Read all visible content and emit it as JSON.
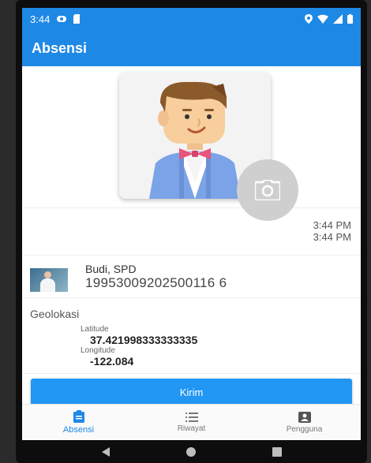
{
  "status_bar": {
    "time": "3:44"
  },
  "app_bar": {
    "title": "Absensi"
  },
  "time_info": {
    "line1": "3:44 PM",
    "line2": "3:44 PM"
  },
  "user": {
    "name": "Budi, SPD",
    "nip": "19953009202500116 6"
  },
  "geo": {
    "title": "Geolokasi",
    "latitude_label": "Latitude",
    "latitude_value": "37.421998333333335",
    "longitude_label": "Longitude",
    "longitude_value": "-122.084"
  },
  "submit": {
    "label": "Kirim"
  },
  "bottom_nav": {
    "items": [
      {
        "label": "Absensi",
        "icon": "clipboard-icon"
      },
      {
        "label": "Riwayat",
        "icon": "list-icon"
      },
      {
        "label": "Pengguna",
        "icon": "person-card-icon"
      }
    ]
  },
  "colors": {
    "primary": "#1e88e5",
    "button": "#2196f3"
  }
}
